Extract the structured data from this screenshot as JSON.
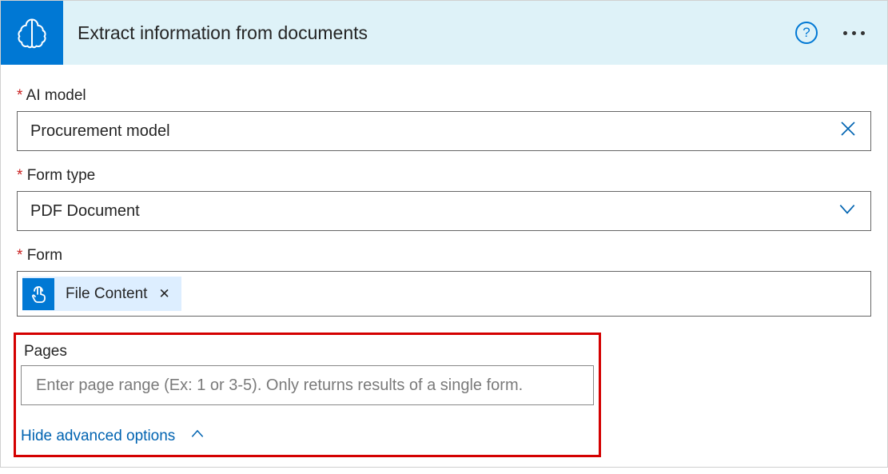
{
  "header": {
    "title": "Extract information from documents"
  },
  "fields": {
    "aiModel": {
      "label": "AI model",
      "value": "Procurement model"
    },
    "formType": {
      "label": "Form type",
      "value": "PDF Document"
    },
    "form": {
      "label": "Form",
      "tokenText": "File Content"
    },
    "pages": {
      "label": "Pages",
      "placeholder": "Enter page range (Ex: 1 or 3-5). Only returns results of a single form."
    }
  },
  "advancedLink": "Hide advanced options"
}
